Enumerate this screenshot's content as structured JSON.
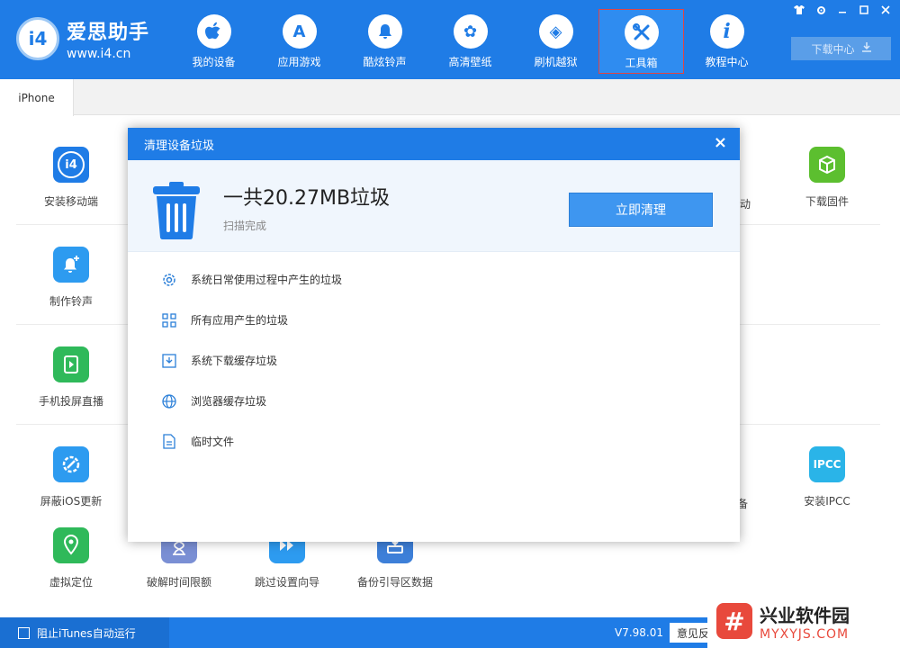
{
  "app": {
    "logo_badge": "i4",
    "name": "爱思助手",
    "url": "www.i4.cn"
  },
  "nav": [
    {
      "label": "我的设备",
      "icon": "apple-icon",
      "glyph": ""
    },
    {
      "label": "应用游戏",
      "icon": "app-store-icon",
      "glyph": "A"
    },
    {
      "label": "酷炫铃声",
      "icon": "bell-icon",
      "glyph": "♪"
    },
    {
      "label": "高清壁纸",
      "icon": "flower-icon",
      "glyph": "✿"
    },
    {
      "label": "刷机越狱",
      "icon": "dropbox-icon",
      "glyph": "◈"
    },
    {
      "label": "工具箱",
      "icon": "tools-icon",
      "glyph": "✂"
    },
    {
      "label": "教程中心",
      "icon": "info-icon",
      "glyph": "i"
    }
  ],
  "active_nav": "工具箱",
  "download_center": "下载中心",
  "tab": "iPhone",
  "tools": {
    "install_mobile": "安装移动端",
    "download_firmware": "下载固件",
    "make_ringtone": "制作铃声",
    "screen_mirror": "手机投屏直播",
    "block_ios_update": "屏蔽iOS更新",
    "install_ipcc": "安装IPCC",
    "ipcc_badge": "IPCC",
    "virtual_location": "虚拟定位",
    "crack_time_limit": "破解时间限额",
    "skip_setup": "跳过设置向导",
    "backup_boot": "备份引导区数据",
    "partial_1": "动",
    "partial_2": "备"
  },
  "dialog": {
    "title": "清理设备垃圾",
    "close": "×",
    "total": "一共20.27MB垃圾",
    "status": "扫描完成",
    "clean_button": "立即清理",
    "categories": [
      {
        "label": "系统日常使用过程中产生的垃圾",
        "icon": "gear-icon"
      },
      {
        "label": "所有应用产生的垃圾",
        "icon": "grid-icon"
      },
      {
        "label": "系统下载缓存垃圾",
        "icon": "download-icon"
      },
      {
        "label": "浏览器缓存垃圾",
        "icon": "globe-icon"
      },
      {
        "label": "临时文件",
        "icon": "file-icon"
      }
    ]
  },
  "footer": {
    "itunes_label": "阻止iTunes自动运行",
    "version": "V7.98.01",
    "feedback": "意见反"
  },
  "watermark": {
    "mark": "#",
    "title": "兴业软件园",
    "url": "MYXYJS.COM"
  },
  "colors": {
    "primary": "#1f7ce6",
    "button": "#3e96f0",
    "green": "#2fb95a",
    "accent_red": "#e8493c"
  }
}
